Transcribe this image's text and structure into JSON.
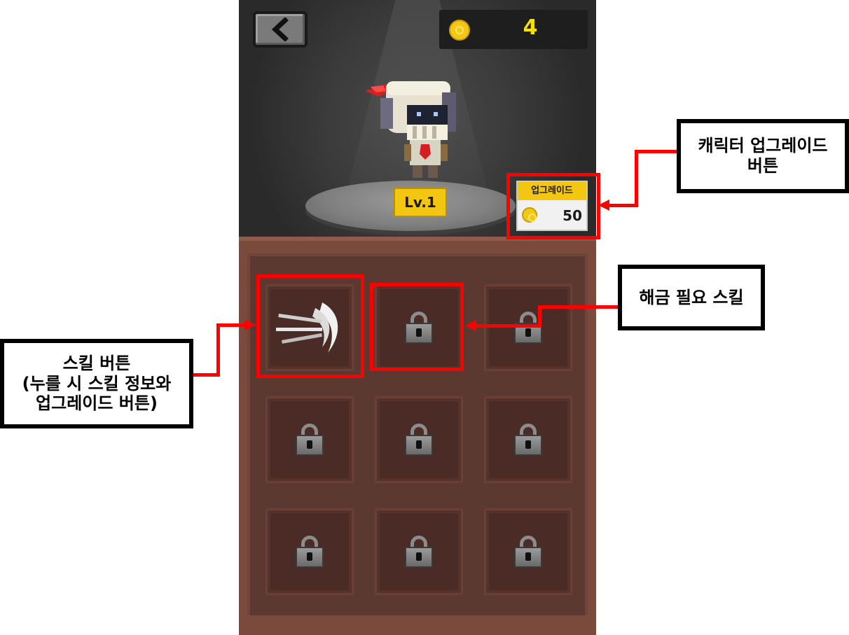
{
  "header": {
    "coin_count": "4"
  },
  "character": {
    "level_label": "Lv.1"
  },
  "upgrade_button": {
    "label": "업그레이드",
    "cost": "50"
  },
  "annotations": {
    "character_upgrade": [
      "캐릭터 업그레이드",
      "버튼"
    ],
    "locked_skill": [
      "해금 필요 스킬"
    ],
    "skill_button": [
      "스킬 버튼",
      "(누를 시 스킬 정보와",
      "업그레이드 버튼)"
    ]
  },
  "colors": {
    "highlight": "#ff0000",
    "gold": "#f3c611",
    "coin_text": "#f5e000",
    "board": "#7a4a3d"
  },
  "icons": {
    "back": "chevron-left-icon",
    "coin": "coin-icon",
    "skill": "claw-slash-icon",
    "locked": "padlock-icon"
  }
}
